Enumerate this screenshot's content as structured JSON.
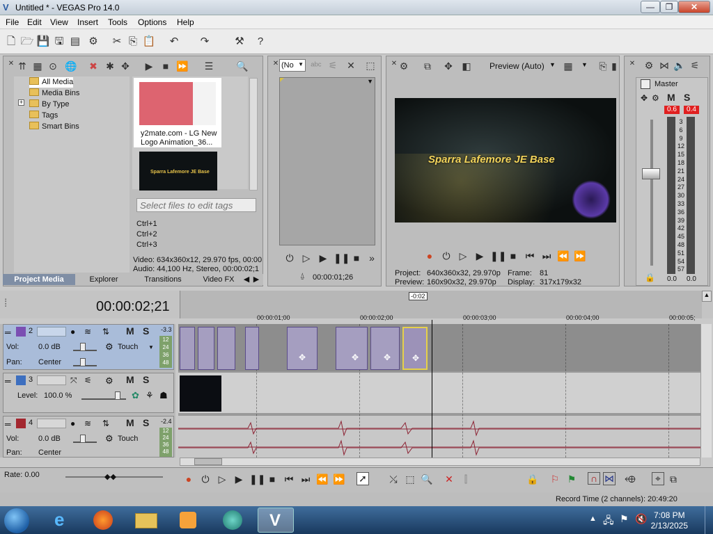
{
  "window": {
    "title": "Untitled * - VEGAS Pro 14.0",
    "min": "—",
    "max": "❐",
    "close": "✕"
  },
  "menu": [
    "File",
    "Edit",
    "View",
    "Insert",
    "Tools",
    "Options",
    "Help"
  ],
  "media_tree": {
    "items": [
      {
        "label": "All Media",
        "selected": true
      },
      {
        "label": "Media Bins"
      },
      {
        "label": "By Type",
        "expander": "+"
      },
      {
        "label": "Tags"
      },
      {
        "label": "Smart Bins"
      }
    ]
  },
  "thumbnails": [
    {
      "caption": "y2mate.com - LG New Logo Animation_36..."
    },
    {
      "caption": "",
      "overlay_text": "Sparra Lafemore JE Base"
    }
  ],
  "tags": {
    "placeholder": "Select files to edit tags",
    "shortcuts": [
      "Ctrl+1",
      "Ctrl+2",
      "Ctrl+3"
    ]
  },
  "media_info": {
    "video": "Video: 634x360x12, 29.970 fps, 00:00",
    "audio": "Audio: 44,100 Hz, Stereo, 00:00:02;1"
  },
  "tabs": [
    {
      "label": "Project Media",
      "active": true
    },
    {
      "label": "Explorer"
    },
    {
      "label": "Transitions"
    },
    {
      "label": "Video FX"
    }
  ],
  "trimmer": {
    "dropdown": "(No",
    "timecode": "00:00:01;26"
  },
  "preview": {
    "quality": "Preview (Auto)",
    "title_text": "Sparra Lafemore JE Base",
    "project_label": "Project:",
    "project_value": "640x360x32, 29.970p",
    "frame_label": "Frame:",
    "frame_value": "81",
    "preview_label": "Preview:",
    "preview_value": "160x90x32, 29.970p",
    "display_label": "Display:",
    "display_value": "317x179x32"
  },
  "master": {
    "label": "Master",
    "m": "M",
    "s": "S",
    "peak_left": "0.6",
    "peak_right": "0.4",
    "scale": [
      "3",
      "6",
      "9",
      "12",
      "15",
      "18",
      "21",
      "24",
      "27",
      "30",
      "33",
      "36",
      "39",
      "42",
      "45",
      "48",
      "51",
      "54",
      "57"
    ],
    "level_left": "0.0",
    "level_right": "0.0"
  },
  "timeline": {
    "timecode": "00:00:02;21",
    "marker": "-0:02",
    "ruler": [
      "00:00:01;00",
      "00:00:02;00",
      "00:00:03;00",
      "00:00:04;00",
      "00:00:05;"
    ],
    "tracks": [
      {
        "num": "2",
        "vol_label": "Vol:",
        "vol": "0.0 dB",
        "pan_label": "Pan:",
        "pan": "Center",
        "mode": "Touch",
        "m": "M",
        "s": "S",
        "peak": "-3.3",
        "meter": [
          "12",
          "24",
          "36",
          "48"
        ],
        "color": "#7b4fb2"
      },
      {
        "num": "3",
        "level_label": "Level:",
        "level": "100.0 %",
        "m": "M",
        "s": "S",
        "color": "#3d6fbf"
      },
      {
        "num": "4",
        "vol_label": "Vol:",
        "vol": "0.0 dB",
        "pan_label": "Pan:",
        "pan": "Center",
        "mode": "Touch",
        "m": "M",
        "s": "S",
        "peak": "-2.4",
        "meter": [
          "12",
          "24",
          "36",
          "48"
        ],
        "color": "#a3272f"
      }
    ]
  },
  "rate": {
    "label": "Rate: 0.00"
  },
  "status": {
    "record_time": "Record Time (2 channels): 20:49:20"
  },
  "clock": {
    "time": "7:08 PM",
    "date": "2/13/2025"
  }
}
